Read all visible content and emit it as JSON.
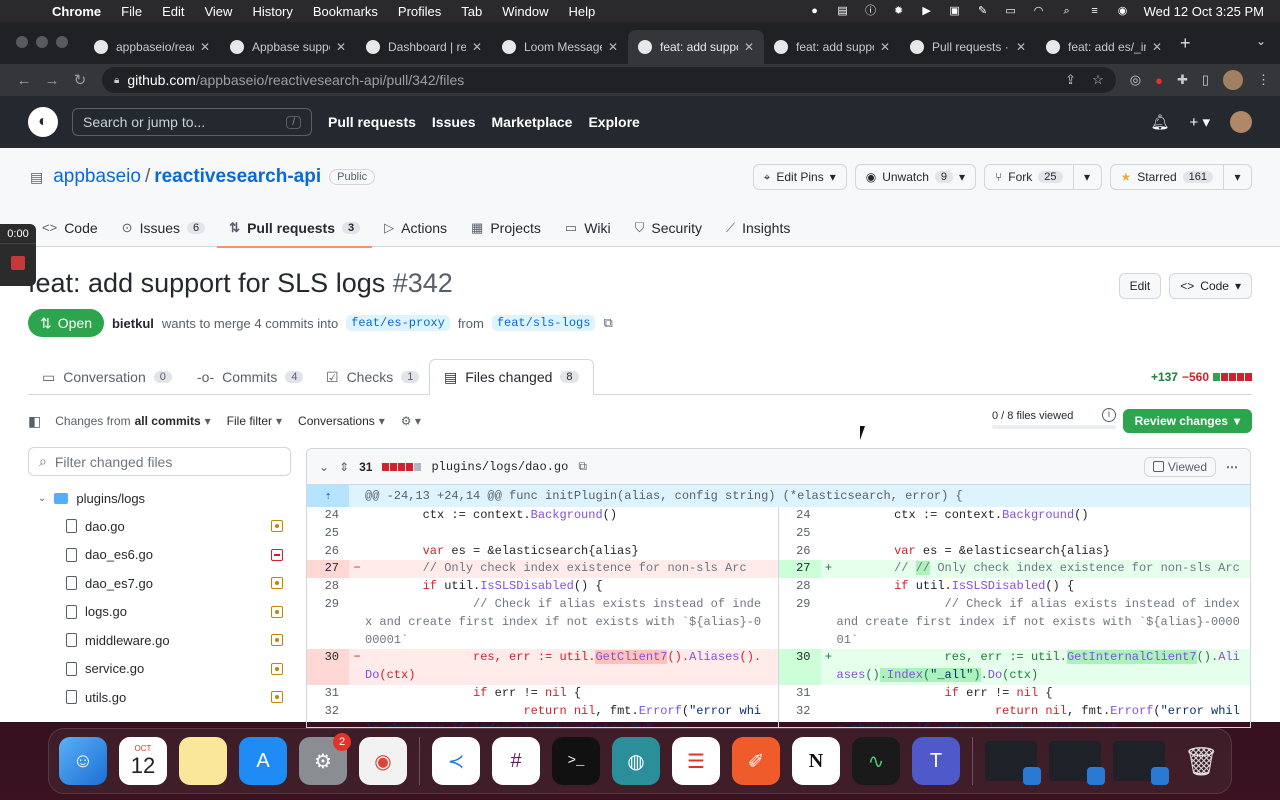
{
  "menubar": {
    "app": "Chrome",
    "items": [
      "File",
      "Edit",
      "View",
      "History",
      "Bookmarks",
      "Profiles",
      "Tab",
      "Window",
      "Help"
    ],
    "clock": "Wed 12 Oct  3:25 PM"
  },
  "browser": {
    "tabs": [
      {
        "title": "appbaseio/reac",
        "icon": "github-icon"
      },
      {
        "title": "Appbase suppo",
        "icon": "appbase-icon"
      },
      {
        "title": "Dashboard | rea",
        "icon": "dashboard-icon"
      },
      {
        "title": "Loom Message",
        "icon": "loom-icon"
      },
      {
        "title": "feat: add suppo",
        "icon": "github-icon"
      },
      {
        "title": "feat: add suppo",
        "icon": "github-icon"
      },
      {
        "title": "Pull requests · a",
        "icon": "github-icon"
      },
      {
        "title": "feat: add es/_in",
        "icon": "github-icon"
      }
    ],
    "active_tab": 4,
    "url_host": "github.com",
    "url_path": "/appbaseio/reactivesearch-api/pull/342/files"
  },
  "github": {
    "search_placeholder": "Search or jump to...",
    "search_key": "/",
    "nav": [
      "Pull requests",
      "Issues",
      "Marketplace",
      "Explore"
    ]
  },
  "repo": {
    "owner": "appbaseio",
    "name": "reactivesearch-api",
    "visibility": "Public",
    "actions": {
      "edit_pins": "Edit Pins",
      "unwatch": "Unwatch",
      "unwatch_count": "9",
      "fork": "Fork",
      "fork_count": "25",
      "starred": "Starred",
      "star_count": "161"
    },
    "tabs": [
      {
        "label": "Code",
        "count": ""
      },
      {
        "label": "Issues",
        "count": "6"
      },
      {
        "label": "Pull requests",
        "count": "3"
      },
      {
        "label": "Actions",
        "count": ""
      },
      {
        "label": "Projects",
        "count": ""
      },
      {
        "label": "Wiki",
        "count": ""
      },
      {
        "label": "Security",
        "count": ""
      },
      {
        "label": "Insights",
        "count": ""
      }
    ]
  },
  "recorder": {
    "time": "0:00"
  },
  "pr": {
    "title": "feat: add support for SLS logs",
    "number": "#342",
    "edit": "Edit",
    "code": "Code",
    "state": "Open",
    "author": "bietkul",
    "meta_text": "wants to merge 4 commits into",
    "base": "feat/es-proxy",
    "from": "from",
    "head": "feat/sls-logs",
    "tabs": [
      {
        "label": "Conversation",
        "count": "0"
      },
      {
        "label": "Commits",
        "count": "4"
      },
      {
        "label": "Checks",
        "count": "1"
      },
      {
        "label": "Files changed",
        "count": "8"
      }
    ],
    "additions": "+137",
    "deletions": "−560"
  },
  "toolbar": {
    "changes_from": "Changes from",
    "all_commits": "all commits",
    "file_filter": "File filter",
    "conversations": "Conversations",
    "files_viewed": "0 / 8 files viewed",
    "review": "Review changes"
  },
  "sidebar": {
    "filter_placeholder": "Filter changed files",
    "folder": "plugins/logs",
    "files": [
      {
        "name": "dao.go",
        "status": "modified"
      },
      {
        "name": "dao_es6.go",
        "status": "removed"
      },
      {
        "name": "dao_es7.go",
        "status": "modified"
      },
      {
        "name": "logs.go",
        "status": "modified"
      },
      {
        "name": "middleware.go",
        "status": "modified"
      },
      {
        "name": "service.go",
        "status": "modified"
      },
      {
        "name": "utils.go",
        "status": "modified"
      }
    ]
  },
  "diff": {
    "changes": "31",
    "filename": "plugins/logs/dao.go",
    "viewed": "Viewed",
    "hunk": "@@ -24,13 +24,14 @@ func initPlugin(alias, config string) (*elasticsearch, error) {"
  },
  "dock": {
    "calendar_month": "OCT",
    "calendar_day": "12",
    "settings_badge": "2"
  }
}
